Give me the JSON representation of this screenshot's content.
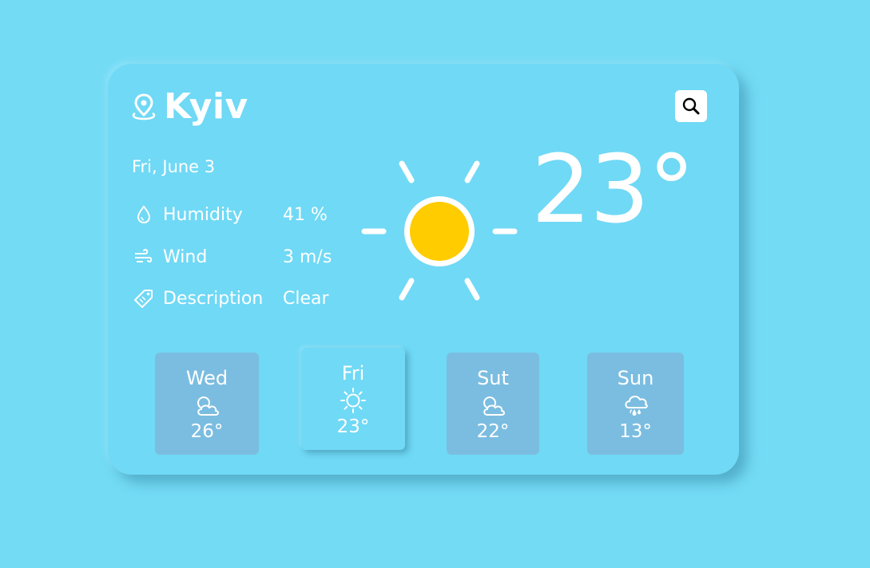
{
  "location": {
    "city": "Kyiv"
  },
  "date": "Fri, June 3",
  "details": [
    {
      "label": "Humidity",
      "value": "41 %",
      "icon": "water-drop-icon"
    },
    {
      "label": "Wind",
      "value": "3 m/s",
      "icon": "wind-icon"
    },
    {
      "label": "Description",
      "value": "Clear",
      "icon": "tag-icon"
    }
  ],
  "current": {
    "temp": "23°",
    "icon": "sun-icon"
  },
  "forecast": [
    {
      "day": "Wed",
      "temp": "26°",
      "icon": "cloudy-icon"
    },
    {
      "day": "Fri",
      "temp": "23°",
      "icon": "sun-icon"
    },
    {
      "day": "Sut",
      "temp": "22°",
      "icon": "cloudy-icon"
    },
    {
      "day": "Sun",
      "temp": "13°",
      "icon": "rain-icon"
    }
  ],
  "colors": {
    "background": "#74dbf5",
    "card": "#70d9f5",
    "forecast_tile": "#7bbde0",
    "sun": "#ffcc00",
    "text": "#ffffff"
  }
}
